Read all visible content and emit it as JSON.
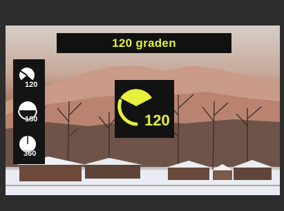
{
  "screen": {
    "title": "120 graden"
  },
  "options": [
    {
      "id": "opt-120",
      "label": "120",
      "icon": "angle-120-icon"
    },
    {
      "id": "opt-180",
      "label": "180",
      "icon": "angle-180-icon"
    },
    {
      "id": "opt-360",
      "label": "360",
      "icon": "angle-360-icon"
    }
  ],
  "selected": {
    "label": "120",
    "icon": "angle-120-large-icon"
  },
  "colors": {
    "accent": "#e6f03a",
    "panel": "#121212",
    "frame": "#2d2d2d"
  }
}
